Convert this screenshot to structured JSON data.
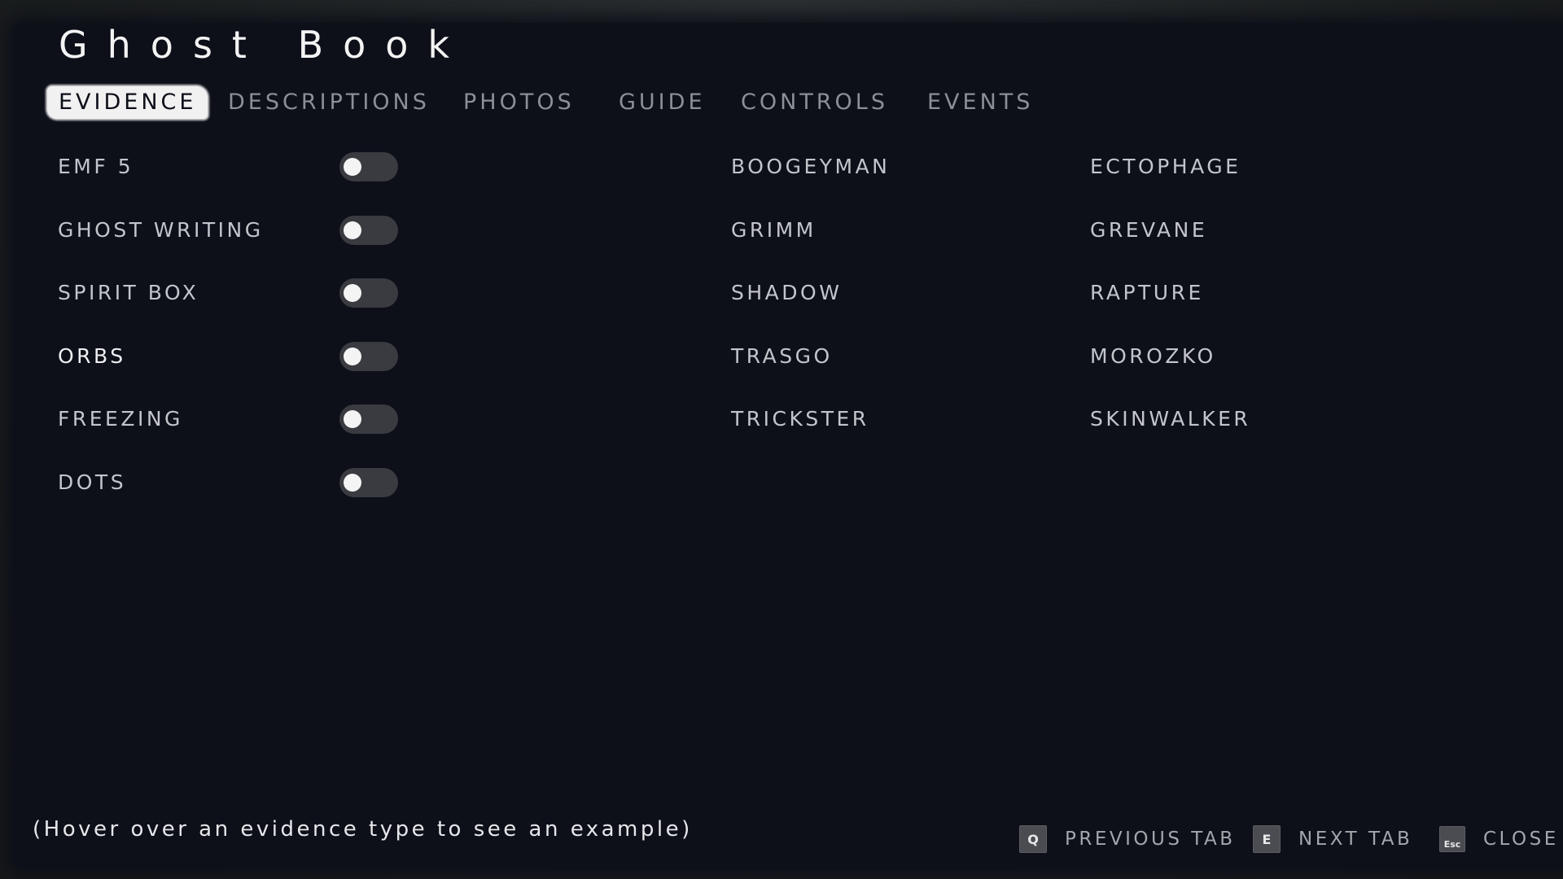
{
  "title": "Ghost Book",
  "tabs": [
    {
      "label": "EVIDENCE",
      "active": true
    },
    {
      "label": "DESCRIPTIONS",
      "active": false
    },
    {
      "label": "PHOTOS",
      "active": false
    },
    {
      "label": "GUIDE",
      "active": false
    },
    {
      "label": "CONTROLS",
      "active": false
    },
    {
      "label": "EVENTS",
      "active": false
    }
  ],
  "evidence": [
    {
      "label": "EMF 5",
      "enabled": false
    },
    {
      "label": "GHOST WRITING",
      "enabled": false
    },
    {
      "label": "SPIRIT BOX",
      "enabled": false
    },
    {
      "label": "ORBS",
      "enabled": false
    },
    {
      "label": "FREEZING",
      "enabled": false
    },
    {
      "label": "DOTS",
      "enabled": false
    }
  ],
  "ghosts_col1": [
    "BOOGEYMAN",
    "GRIMM",
    "SHADOW",
    "TRASGO",
    "TRICKSTER"
  ],
  "ghosts_col2": [
    "ECTOPHAGE",
    "GREVANE",
    "RAPTURE",
    "MOROZKO",
    "SKINWALKER"
  ],
  "hint": "(Hover over an evidence type to see an example)",
  "footer": {
    "previous": {
      "key": "Q",
      "label": "PREVIOUS TAB"
    },
    "next": {
      "key": "E",
      "label": "NEXT TAB"
    },
    "close": {
      "key": "Esc",
      "label": "CLOSE"
    }
  },
  "colors": {
    "panel": "#0d0f19",
    "active_tab_bg": "#f1f1f1",
    "text": "#c3c5cb"
  }
}
